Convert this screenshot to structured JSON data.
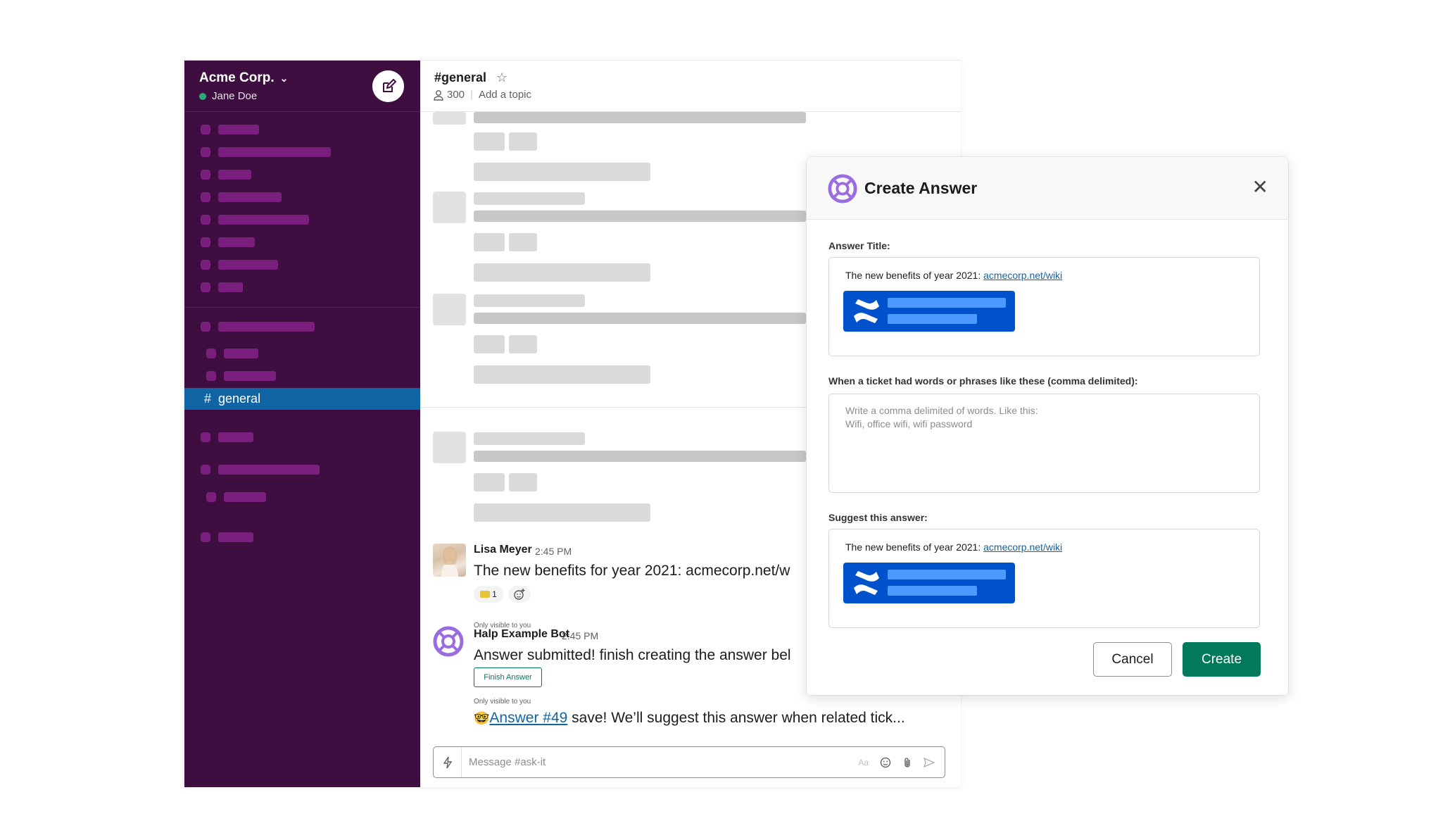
{
  "workspace": {
    "name": "Acme Corp.",
    "user": "Jane Doe",
    "presence_color": "#2bac76"
  },
  "sidebar": {
    "active_channel": "general",
    "bg_color": "#3f0e40",
    "active_color": "#1164a3"
  },
  "channel": {
    "name": "#general",
    "members": "300",
    "topic_placeholder": "Add a topic"
  },
  "messages": {
    "lisa": {
      "author": "Lisa Meyer",
      "time": "2:45 PM",
      "text": "The new benefits for year 2021: acmecorp.net/w",
      "reaction_count": "1"
    },
    "bot": {
      "visibility": "Only visible to you",
      "author": "Halp Example Bot",
      "time": "2:45 PM",
      "text": "Answer submitted! finish creating the answer bel",
      "button": "Finish Answer"
    },
    "bot2": {
      "visibility": "Only visible to you",
      "emoji": "🤓",
      "link": "Answer #49",
      "text": " save! We’ll suggest this answer when related tick..."
    }
  },
  "composer": {
    "placeholder": "Message #ask-it",
    "format_label": "Aa"
  },
  "modal": {
    "title": "Create Answer",
    "answer_title_label": "Answer Title:",
    "answer_prefix": "The new benefits of year 2021: ",
    "answer_link": "acmecorp.net/wiki",
    "keywords_label": "When a ticket had words or phrases like these (comma delimited):",
    "keywords_placeholder_line1": "Write a comma delimited of words. Like this:",
    "keywords_placeholder_line2": "Wifi, office wifi, wifi password",
    "suggest_label": "Suggest this answer:",
    "suggest_prefix": "The new benefits of year 2021: ",
    "suggest_link": "acmecorp.net/wiki",
    "cancel": "Cancel",
    "create": "Create",
    "create_color": "#007a5a",
    "card_color": "#0052cc"
  }
}
